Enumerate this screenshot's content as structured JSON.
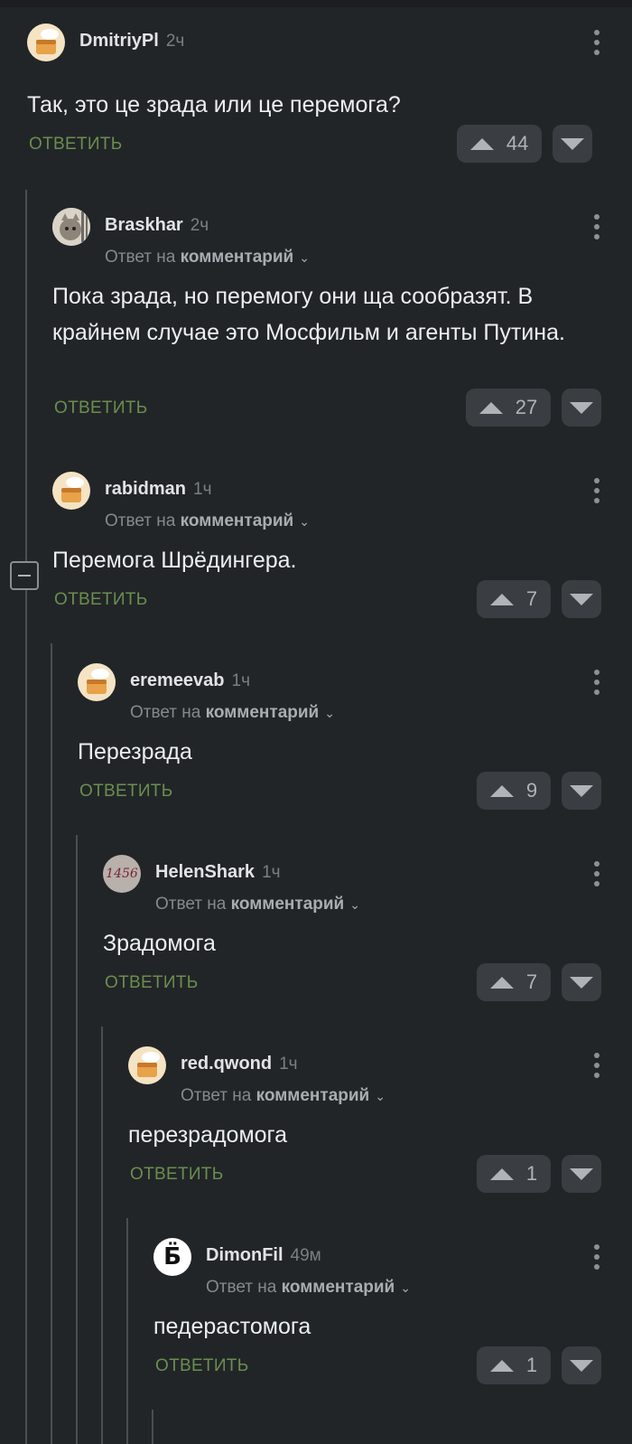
{
  "comments": [
    {
      "user": "DmitriyPl",
      "time": "2ч",
      "reply_to": null,
      "text": "Так, это це зрада или це перемога?",
      "reply_label": "ОТВЕТИТЬ",
      "votes": "44",
      "avatar": "cake-avatar"
    },
    {
      "user": "Braskhar",
      "time": "2ч",
      "reply_to": {
        "prefix": "Ответ на",
        "target": "комментарий"
      },
      "text": "Пока зрада, но перемогу они ща сообразят. В крайнем случае это Мосфильм и агенты Путина.",
      "reply_label": "ОТВЕТИТЬ",
      "votes": "27",
      "avatar": "cat-avatar"
    },
    {
      "user": "rabidman",
      "time": "1ч",
      "reply_to": {
        "prefix": "Ответ на",
        "target": "комментарий"
      },
      "text": "Перемога Шрёдингера.",
      "reply_label": "ОТВЕТИТЬ",
      "votes": "7",
      "avatar": "cake-avatar"
    },
    {
      "user": "eremeevab",
      "time": "1ч",
      "reply_to": {
        "prefix": "Ответ на",
        "target": "комментарий"
      },
      "text": "Перезрада",
      "reply_label": "ОТВЕТИТЬ",
      "votes": "9",
      "avatar": "cake-avatar"
    },
    {
      "user": "HelenShark",
      "time": "1ч",
      "reply_to": {
        "prefix": "Ответ на",
        "target": "комментарий"
      },
      "text": "Зрадомога",
      "reply_label": "ОТВЕТИТЬ",
      "votes": "7",
      "avatar": "helen-avatar",
      "avatar_text": "1456"
    },
    {
      "user": "red.qwond",
      "time": "1ч",
      "reply_to": {
        "prefix": "Ответ на",
        "target": "комментарий"
      },
      "text": "перезрадомога",
      "reply_label": "ОТВЕТИТЬ",
      "votes": "1",
      "avatar": "cake-avatar"
    },
    {
      "user": "DimonFil",
      "time": "49м",
      "reply_to": {
        "prefix": "Ответ на",
        "target": "комментарий"
      },
      "text": "педерастомога",
      "reply_label": "ОТВЕТИТЬ",
      "votes": "1",
      "avatar": "letter-avatar",
      "avatar_text": "Б̈"
    }
  ],
  "colors": {
    "background": "#222528",
    "reply": "#6a8e4e",
    "vote_bg": "#3a3d41"
  }
}
